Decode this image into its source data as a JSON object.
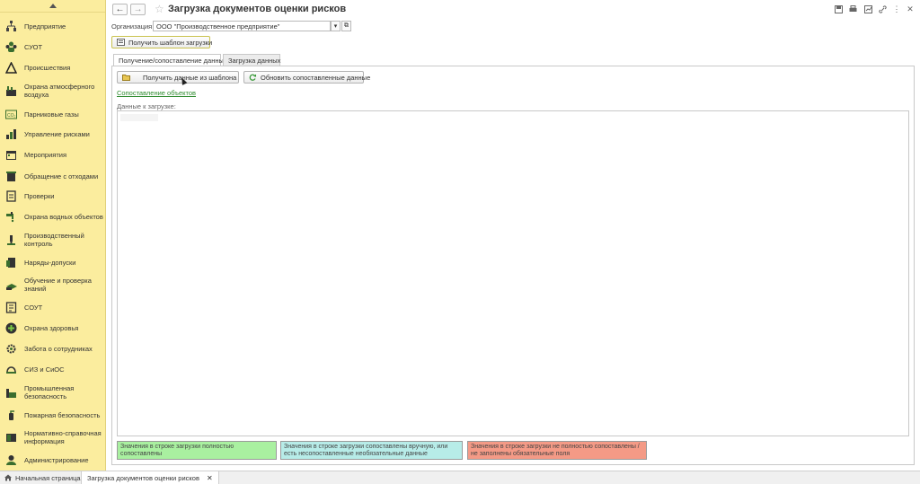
{
  "sidebar": {
    "items": [
      {
        "label": "Предприятие",
        "icon": "org-structure-icon"
      },
      {
        "label": "СУОТ",
        "icon": "people-group-icon"
      },
      {
        "label": "Происшествия",
        "icon": "warning-triangle-icon"
      },
      {
        "label": "Охрана атмосферного воздуха",
        "icon": "air-factory-icon"
      },
      {
        "label": "Парниковые газы",
        "icon": "co2-icon"
      },
      {
        "label": "Управление рисками",
        "icon": "risk-chart-icon"
      },
      {
        "label": "Мероприятия",
        "icon": "calendar-icon"
      },
      {
        "label": "Обращение с отходами",
        "icon": "waste-bin-icon"
      },
      {
        "label": "Проверки",
        "icon": "checklist-icon"
      },
      {
        "label": "Охрана водных объектов",
        "icon": "water-tap-icon"
      },
      {
        "label": "Производственный контроль",
        "icon": "microscope-icon"
      },
      {
        "label": "Наряды-допуски",
        "icon": "permit-doc-icon"
      },
      {
        "label": "Обучение и проверка знаний",
        "icon": "education-icon"
      },
      {
        "label": "СОУТ",
        "icon": "assessment-doc-icon"
      },
      {
        "label": "Охрана здоровья",
        "icon": "health-cross-icon"
      },
      {
        "label": "Забота о сотрудниках",
        "icon": "care-gear-icon"
      },
      {
        "label": "СИЗ и СиОС",
        "icon": "helmet-icon"
      },
      {
        "label": "Промышленная безопасность",
        "icon": "industry-icon"
      },
      {
        "label": "Пожарная безопасность",
        "icon": "fire-extinguisher-icon"
      },
      {
        "label": "Нормативно-справочная информация",
        "icon": "reference-book-icon"
      },
      {
        "label": "Администрирование",
        "icon": "admin-icon"
      }
    ]
  },
  "header": {
    "title": "Загрузка документов оценки рисков",
    "back_icon": "arrow-left-icon",
    "forward_icon": "arrow-right-icon"
  },
  "organization": {
    "label": "Организация:",
    "value": "ООО \"Производственное предприятие\""
  },
  "toolbar": {
    "get_template_label": "Получить шаблон загрузки"
  },
  "tabs": [
    {
      "label": "Получение/сопоставление данных",
      "active": true
    },
    {
      "label": "Загрузка данных",
      "active": false
    }
  ],
  "panel": {
    "get_data_label": "Получить данные из шаблона",
    "refresh_label": "Обновить сопоставленные данные",
    "mapping_link": "Сопоставление объектов",
    "data_label": "Данные к загрузке:"
  },
  "legend": [
    {
      "text": "Значения в строке загрузки полностью сопоставлены",
      "color": "#a9f0a0"
    },
    {
      "text": "Значения в строке загрузки сопоставлены вручную, или есть несопоставленные необязательные данные",
      "color": "#b7ece8"
    },
    {
      "text": "Значения в строке загрузки не полностью сопоставлены / не заполнены обязательные поля",
      "color": "#f49a86"
    }
  ],
  "taskbar": {
    "home_label": "Начальная страница",
    "open_tab_label": "Загрузка документов оценки рисков"
  }
}
